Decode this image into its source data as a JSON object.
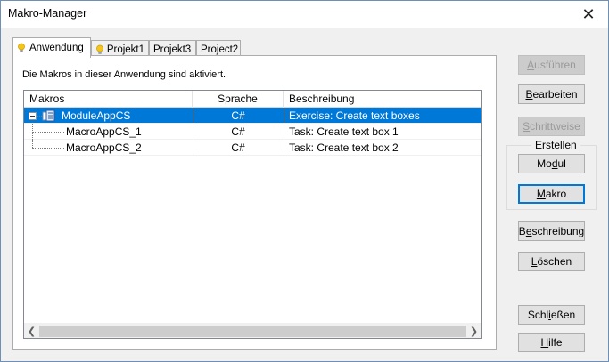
{
  "window": {
    "title": "Makro-Manager"
  },
  "tabs": [
    {
      "label": "Anwendung",
      "active": true,
      "has_icon": true
    },
    {
      "label": "Projekt1",
      "active": false,
      "has_icon": true
    },
    {
      "label": "Projekt3",
      "active": false,
      "has_icon": false
    },
    {
      "label": "Project2",
      "active": false,
      "has_icon": false
    }
  ],
  "panel": {
    "info_text": "Die Makros in dieser Anwendung sind aktiviert.",
    "columns": [
      "Makros",
      "Sprache",
      "Beschreibung"
    ],
    "rows": [
      {
        "name": "ModuleAppCS",
        "language": "C#",
        "description": "Exercise: Create text boxes",
        "selected": true,
        "level": 0,
        "expanded": true
      },
      {
        "name": "MacroAppCS_1",
        "language": "C#",
        "description": "Task: Create text box 1",
        "selected": false,
        "level": 1
      },
      {
        "name": "MacroAppCS_2",
        "language": "C#",
        "description": "Task: Create text box 2",
        "selected": false,
        "level": 1
      }
    ]
  },
  "buttons": {
    "run": {
      "pre": "",
      "accel": "A",
      "post": "usführen",
      "enabled": false
    },
    "edit": {
      "pre": "",
      "accel": "B",
      "post": "earbeiten",
      "enabled": true
    },
    "step": {
      "pre": "",
      "accel": "S",
      "post": "chrittweise",
      "enabled": false
    },
    "create_group_label": "Erstellen",
    "module": {
      "pre": "Mo",
      "accel": "d",
      "post": "ul",
      "enabled": true
    },
    "macro": {
      "pre": "",
      "accel": "M",
      "post": "akro",
      "enabled": true,
      "focused": true
    },
    "description": {
      "pre": "B",
      "accel": "e",
      "post": "schreibung",
      "enabled": true
    },
    "delete": {
      "pre": "",
      "accel": "L",
      "post": "öschen",
      "enabled": true
    },
    "close": {
      "pre": "Schl",
      "accel": "i",
      "post": "eßen",
      "enabled": true
    },
    "help": {
      "pre": "",
      "accel": "H",
      "post": "ilfe",
      "enabled": true
    }
  }
}
